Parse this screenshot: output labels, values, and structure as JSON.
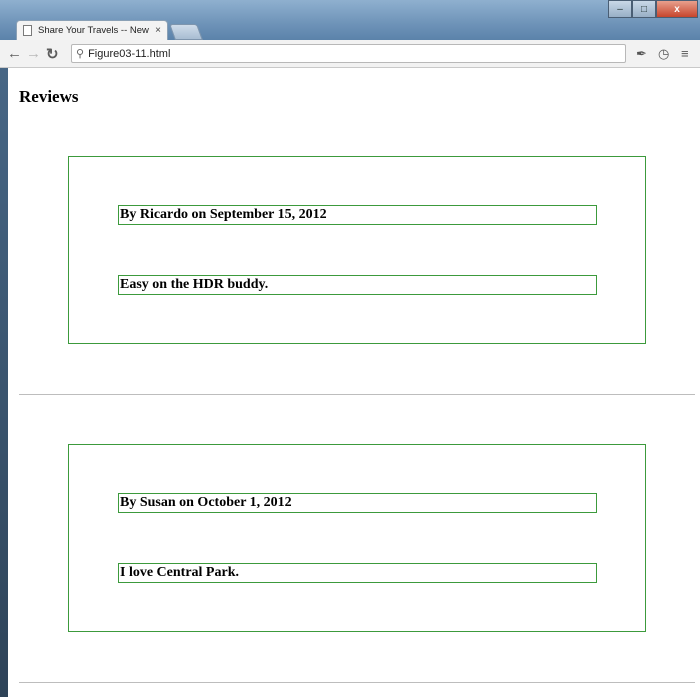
{
  "browser": {
    "tab_title": "Share Your Travels -- New",
    "tab_close": "×",
    "url": "Figure03-11.html",
    "window_buttons": {
      "minimize": "–",
      "maximize": "□",
      "close": "x"
    }
  },
  "page": {
    "heading": "Reviews",
    "reviews": [
      {
        "byline": "By Ricardo on September 15, 2012",
        "comment": "Easy on the HDR buddy."
      },
      {
        "byline": "By Susan on October 1, 2012",
        "comment": "I love Central Park."
      }
    ]
  },
  "colors": {
    "box_border": "#3c9a3c",
    "rule": "#bdbdbd"
  },
  "icons": {
    "page": "document-icon",
    "back": "arrow-left-icon",
    "forward": "arrow-right-icon",
    "reload": "reload-icon",
    "search": "search-icon",
    "dropper": "eyedropper-icon",
    "history": "clock-icon",
    "menu": "hamburger-menu-icon"
  }
}
